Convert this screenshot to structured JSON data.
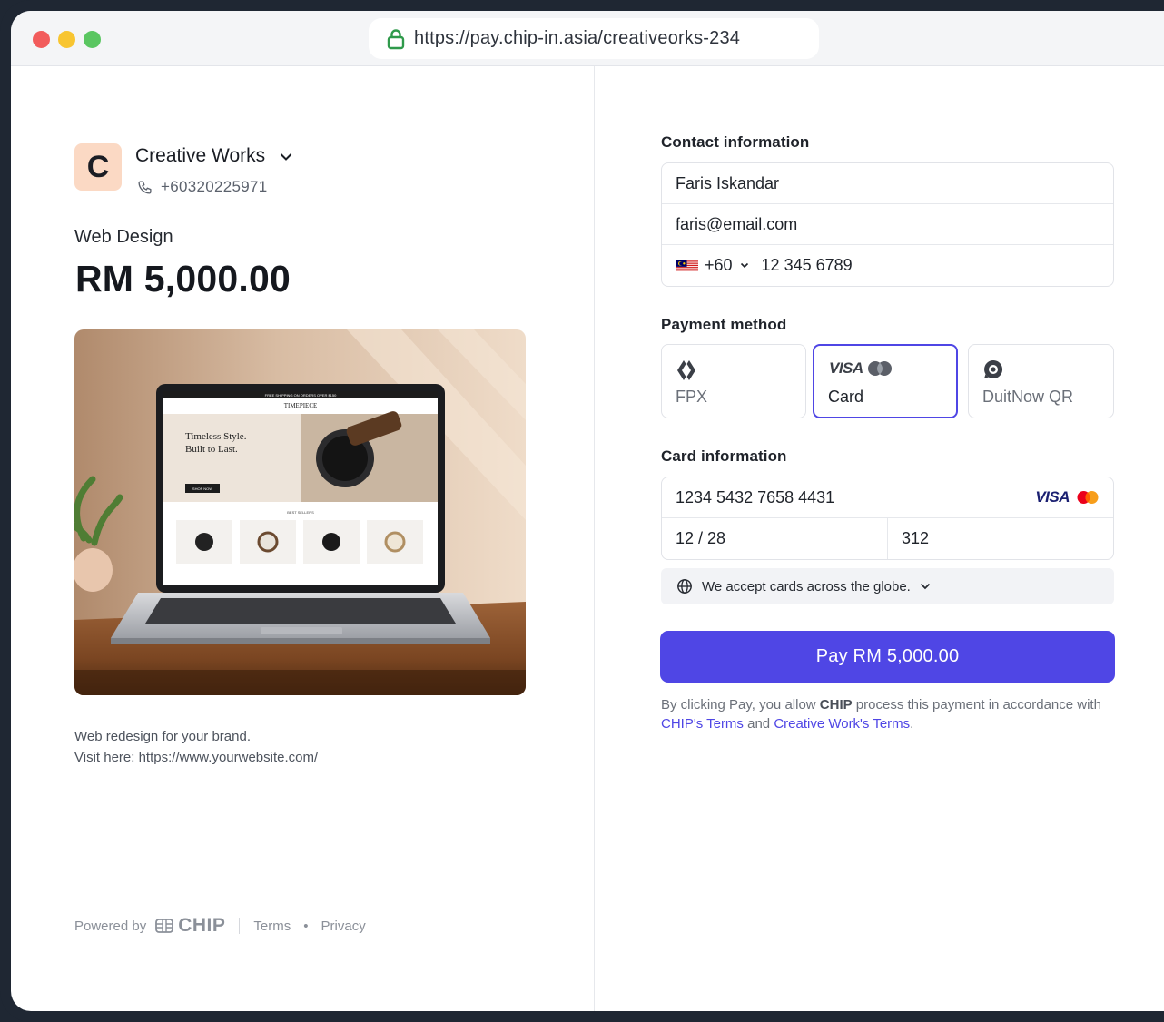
{
  "browser": {
    "url": "https://pay.chip-in.asia/creativeorks-234"
  },
  "merchant": {
    "logo_letter": "C",
    "name": "Creative Works",
    "phone": "+60320225971"
  },
  "product": {
    "name": "Web Design",
    "price": "RM 5,000.00",
    "description_line1": "Web redesign for your brand.",
    "description_line2": "Visit here: https://www.yourwebsite.com/",
    "image_preview": {
      "banner": "FREE SHIPPING ON ORDERS OVER $150",
      "brand": "TIMEPIECE",
      "hero_line1": "Timeless Style.",
      "hero_line2": "Built to Last.",
      "cta": "SHOP NOW",
      "section": "BEST SELLERS"
    }
  },
  "footer": {
    "powered_by": "Powered by",
    "brand": "CHIP",
    "terms": "Terms",
    "bullet": "•",
    "privacy": "Privacy"
  },
  "contact": {
    "label": "Contact information",
    "name": "Faris Iskandar",
    "email": "faris@email.com",
    "country_code": "+60",
    "phone": "12 345 6789"
  },
  "payment": {
    "label": "Payment method",
    "methods": [
      {
        "label": "FPX",
        "icon": "fpx-icon",
        "selected": false
      },
      {
        "label": "Card",
        "icon": "visa-mastercard-icon",
        "selected": true
      },
      {
        "label": "DuitNow QR",
        "icon": "duitnow-icon",
        "selected": false
      }
    ],
    "visa_text": "VISA"
  },
  "card": {
    "label": "Card information",
    "number": "1234 5432 7658 4431",
    "expiry": "12 / 28",
    "cvc": "312",
    "brand_text": "VISA",
    "accept_text": "We accept cards across the globe."
  },
  "pay_button": "Pay RM 5,000.00",
  "legal": {
    "part1": "By clicking Pay, you allow ",
    "chip": "CHIP",
    "part2": " process this payment in accordance with ",
    "chip_terms": "CHIP's Terms",
    "and": " and ",
    "merchant_terms": "Creative Work's Terms",
    "end": "."
  },
  "colors": {
    "accent": "#4f46e5",
    "logo_bg": "#fbd9c4"
  }
}
